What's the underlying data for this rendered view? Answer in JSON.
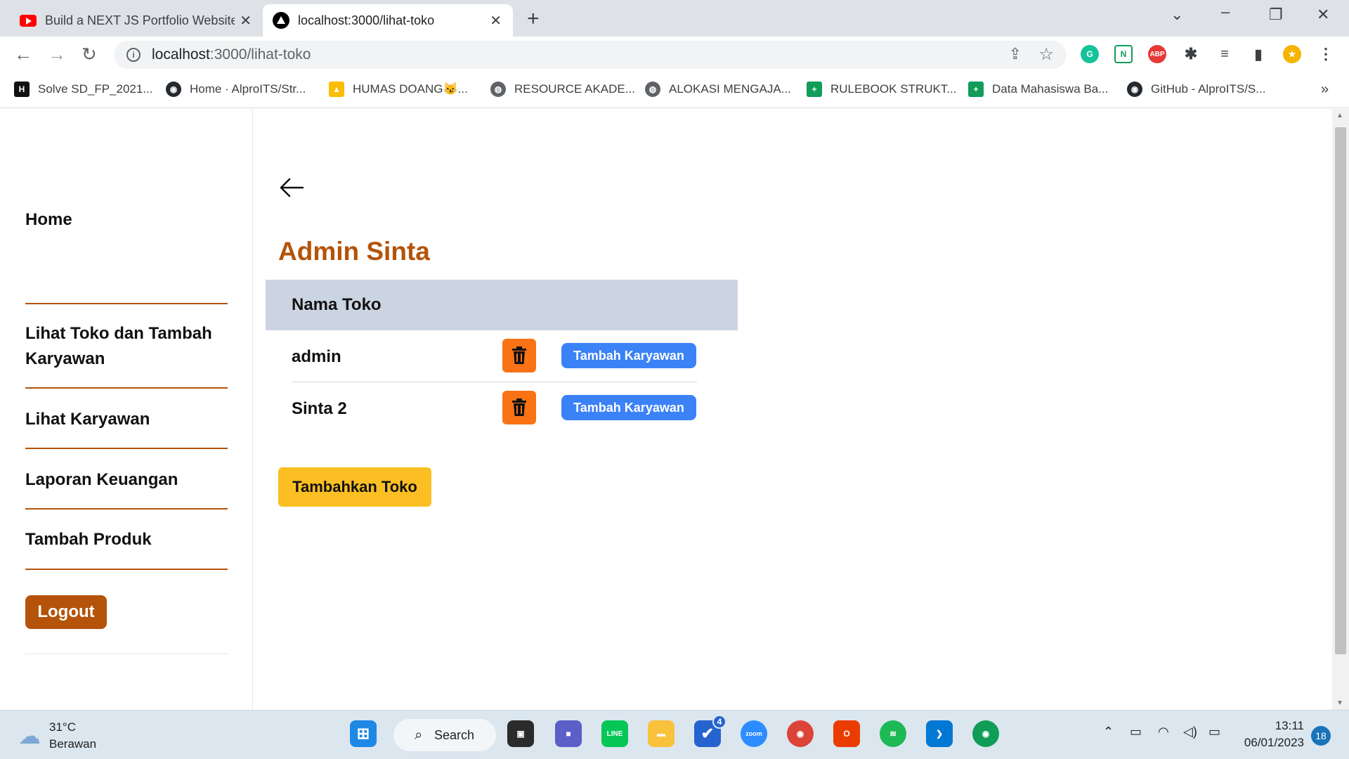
{
  "browser": {
    "tabs": [
      {
        "title": "Build a NEXT JS Portfolio Website",
        "active": false
      },
      {
        "title": "localhost:3000/lihat-toko",
        "active": true
      }
    ],
    "url_host": "localhost",
    "url_path": ":3000/lihat-toko",
    "bookmarks": [
      "Solve SD_FP_2021...",
      "Home · AlproITS/Str...",
      "HUMAS DOANG😼...",
      "RESOURCE AKADE...",
      "ALOKASI MENGAJA...",
      "RULEBOOK STRUKT...",
      "Data Mahasiswa Ba...",
      "GitHub - AlproITS/S..."
    ],
    "bookmarks_more": "»"
  },
  "sidebar": {
    "items": [
      "Home",
      "Lihat Toko dan Tambah Karyawan",
      "Lihat Karyawan",
      "Laporan Keuangan",
      "Tambah Produk"
    ],
    "logout": "Logout"
  },
  "main": {
    "title": "Admin Sinta",
    "table_header": "Nama Toko",
    "rows": [
      {
        "name": "admin",
        "action": "Tambah Karyawan"
      },
      {
        "name": "Sinta 2",
        "action": "Tambah Karyawan"
      }
    ],
    "add_button": "Tambahkan Toko"
  },
  "taskbar": {
    "weather_temp": "31°C",
    "weather_desc": "Berawan",
    "search_label": "Search",
    "todo_badge": "4",
    "time": "13:11",
    "date": "06/01/2023",
    "notif_count": "18"
  },
  "colors": {
    "accent_brown": "#b45309",
    "header_gray": "#cbd5e1",
    "trash_orange": "#f97316",
    "blue_button": "#3b82f6",
    "yellow_button": "#fbbf24"
  }
}
